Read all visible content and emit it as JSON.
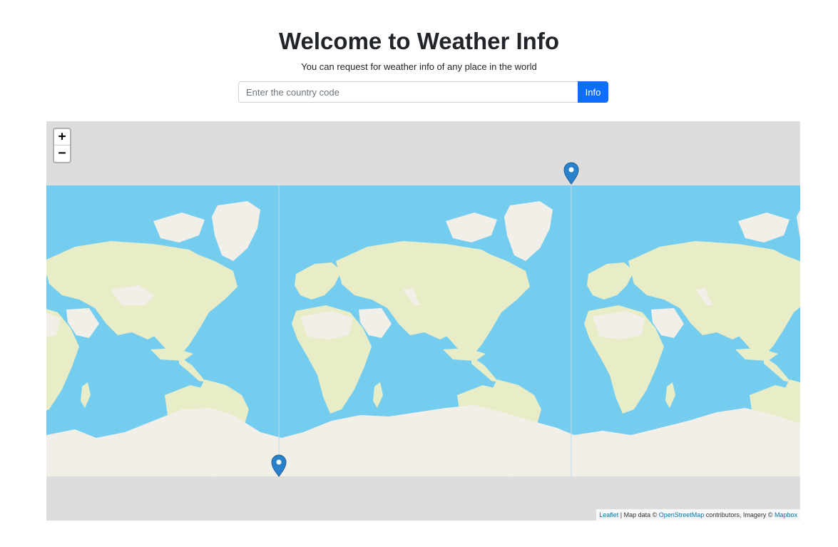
{
  "header": {
    "title": "Welcome to Weather Info",
    "subtitle": "You can request for weather info of any place in the world"
  },
  "search": {
    "placeholder": "Enter the country code",
    "value": "",
    "button_label": "Info"
  },
  "map": {
    "zoom_in_label": "+",
    "zoom_out_label": "−",
    "attribution": {
      "leaflet": "Leaflet",
      "sep1": " | Map data © ",
      "osm": "OpenStreetMap",
      "sep2": " contributors, Imagery © ",
      "mapbox": "Mapbox"
    },
    "colors": {
      "ocean": "#74cdef",
      "land": "#e8edc8",
      "ice": "#f2efe9",
      "grey": "#dddddd",
      "marker": "#2a81cb"
    }
  }
}
